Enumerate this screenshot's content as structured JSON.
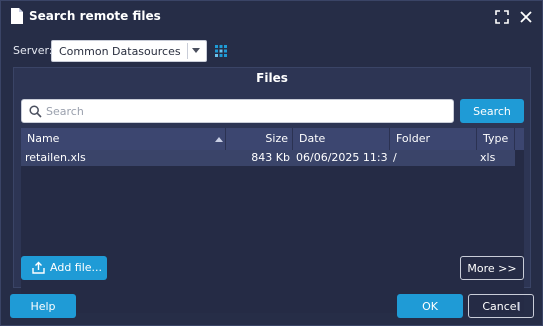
{
  "window": {
    "title": "Search remote files",
    "icons": {
      "document": "document-icon",
      "maximize": "maximize-icon",
      "close": "close-icon"
    }
  },
  "server": {
    "label": "Server:",
    "selected": "Common Datasources",
    "side_icon": "grid-icon"
  },
  "files_panel": {
    "title": "Files",
    "search": {
      "placeholder": "Search",
      "value": "",
      "button_label": "Search",
      "icon": "search-icon"
    },
    "table": {
      "columns": [
        "Name",
        "Size",
        "Date",
        "Folder",
        "Type"
      ],
      "sort_column": "Name",
      "rows": [
        {
          "name": "retailen.xls",
          "size": "843 Kb",
          "date": "06/06/2025 11:3...",
          "folder": "/",
          "type": "xls"
        }
      ]
    },
    "add_file_label": "Add file...",
    "more_label": "More >>"
  },
  "footer": {
    "help_label": "Help",
    "ok_label": "OK",
    "cancel_label": "Cancel"
  },
  "colors": {
    "background": "#262d47",
    "panel": "#2d3554",
    "header": "#3c4670",
    "selected_row": "#3a4469",
    "accent": "#1f9bd6"
  }
}
